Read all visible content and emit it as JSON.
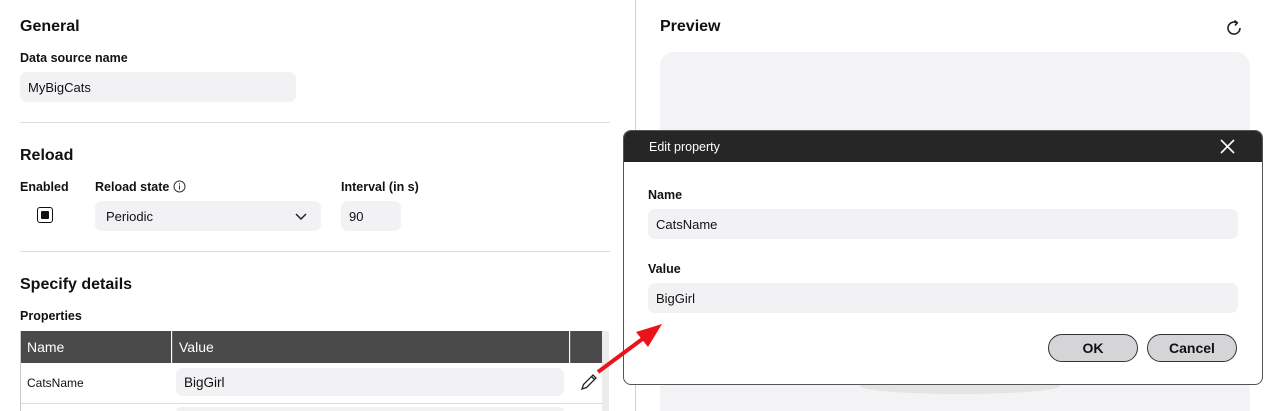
{
  "general": {
    "heading": "General",
    "datasource_label": "Data source name",
    "datasource_value": "MyBigCats"
  },
  "reload": {
    "heading": "Reload",
    "enabled_label": "Enabled",
    "state_label": "Reload state",
    "state_value": "Periodic",
    "interval_label": "Interval (in s)",
    "interval_value": "90"
  },
  "details": {
    "heading": "Specify details",
    "properties_label": "Properties",
    "columns": [
      "Name",
      "Value"
    ],
    "rows": [
      {
        "name": "CatsName",
        "value": "BigGirl"
      }
    ]
  },
  "preview": {
    "heading": "Preview"
  },
  "dialog": {
    "title": "Edit property",
    "name_label": "Name",
    "name_value": "CatsName",
    "value_label": "Value",
    "value_value": "BigGirl",
    "ok_label": "OK",
    "cancel_label": "Cancel"
  },
  "icons": {
    "info": "info-icon",
    "chevron": "chevron-down-icon",
    "edit": "pencil-icon",
    "refresh": "refresh-icon",
    "close": "close-icon"
  },
  "colors": {
    "header_dark": "#262626",
    "table_header": "#4a4a4a",
    "field_bg": "#f2f2f5",
    "arrow": "#e8141a"
  }
}
